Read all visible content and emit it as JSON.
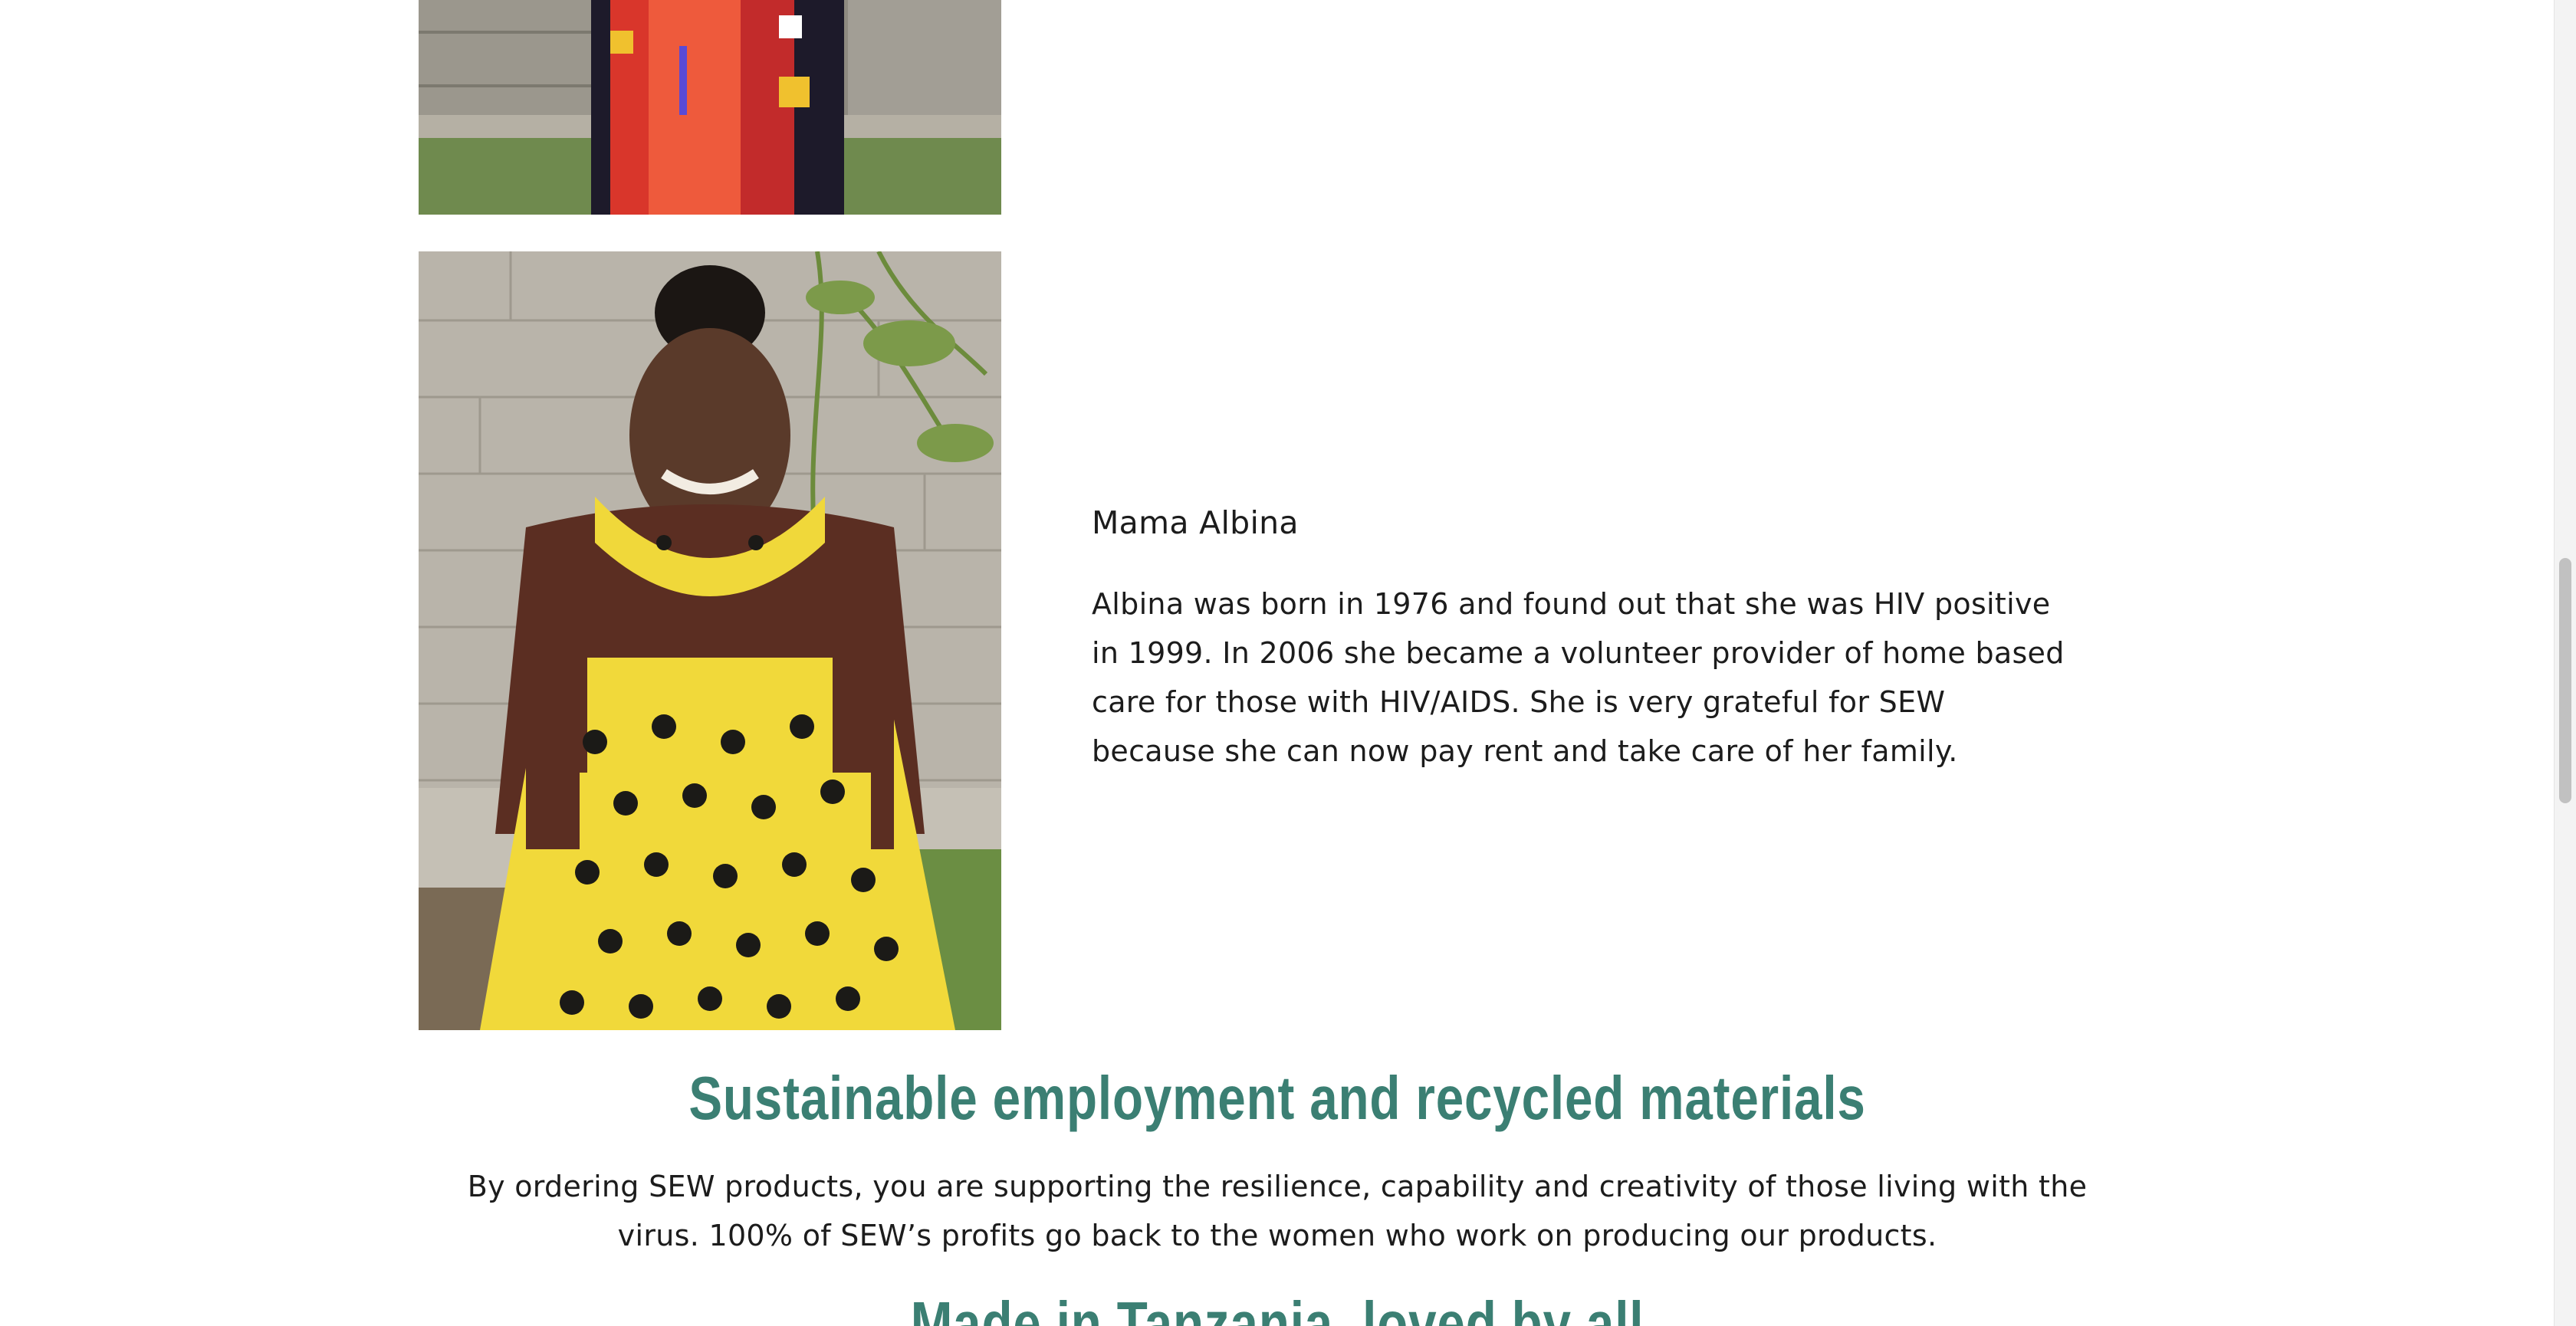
{
  "profile": {
    "name": "Mama Albina",
    "bio": "Albina was born in 1976 and found out that she was HIV positive in 1999. In 2006 she became a volunteer provider of home based care for those with HIV/AIDS. She is very grateful for SEW because she can now pay rent and take care of her family."
  },
  "section": {
    "heading": "Sustainable employment and recycled materials",
    "text": "By ordering SEW products, you are supporting the resilience, capability and creativity of those living with the virus. 100% of SEW’s profits go back to the women who work on producing our products.",
    "next_heading": "Made in Tanzania, loved by all"
  },
  "colors": {
    "accent": "#3b7f73",
    "text": "#1c1c1c",
    "background": "#ffffff"
  }
}
